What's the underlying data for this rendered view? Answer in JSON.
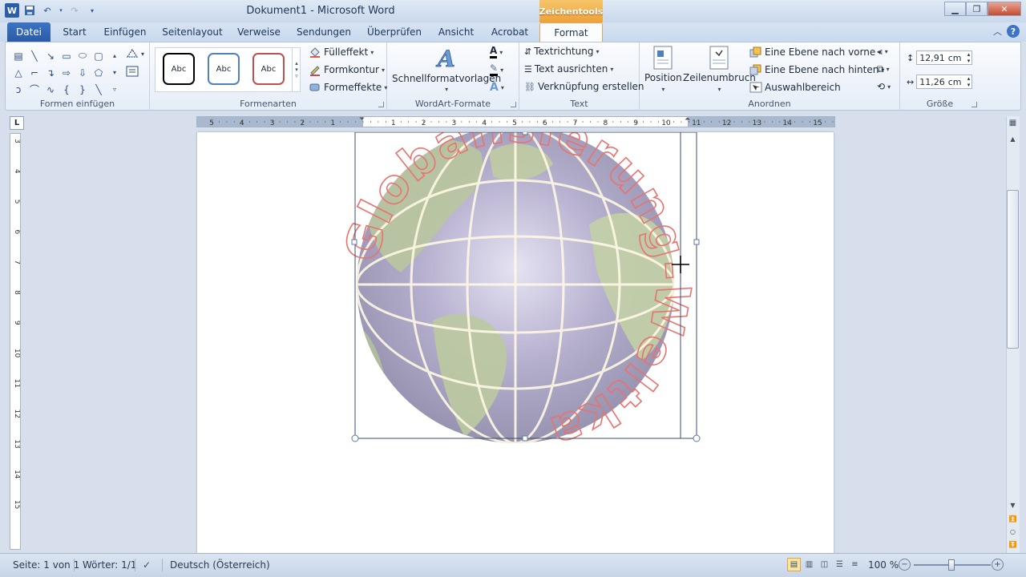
{
  "window": {
    "title": "Dokument1 - Microsoft Word",
    "contextual_tab": "Zeichentools"
  },
  "tabs": [
    {
      "label": "Datei"
    },
    {
      "label": "Start"
    },
    {
      "label": "Einfügen"
    },
    {
      "label": "Seitenlayout"
    },
    {
      "label": "Verweise"
    },
    {
      "label": "Sendungen"
    },
    {
      "label": "Überprüfen"
    },
    {
      "label": "Ansicht"
    },
    {
      "label": "Acrobat"
    },
    {
      "label": "Format"
    }
  ],
  "ribbon": {
    "groups": {
      "insert_shapes": "Formen einfügen",
      "shape_styles": "Formenarten",
      "wordart": "WordArt-Formate",
      "text": "Text",
      "arrange": "Anordnen",
      "size": "Größe"
    },
    "style_sample": "Abc",
    "fill": "Fülleffekt",
    "outline": "Formkontur",
    "effects": "Formeffekte",
    "quick_styles": "Schnellformatvorlagen",
    "text_direction": "Textrichtung",
    "align_text": "Text ausrichten",
    "create_link": "Verknüpfung erstellen",
    "position": "Position",
    "wrap_text": "Zeilenumbruch",
    "bring_forward": "Eine Ebene nach vorne",
    "send_backward": "Eine Ebene nach hinten",
    "selection_pane": "Auswahlbereich",
    "height_value": "12,91",
    "width_value": "11,26",
    "unit": "cm"
  },
  "ruler_corner": "L",
  "ruler_labels": [
    "5",
    "4",
    "3",
    "2",
    "1",
    "1",
    "2",
    "3",
    "4",
    "5",
    "6",
    "7",
    "8",
    "9",
    "10",
    "11",
    "12",
    "13",
    "14",
    "15"
  ],
  "vertical_ruler_labels": [
    "3",
    "4",
    "5",
    "6",
    "7",
    "8",
    "9",
    "10",
    "11",
    "12",
    "13",
    "14",
    "15"
  ],
  "wordart_text": "Globalisierung-Weltkarte",
  "status": {
    "page": "Seite: 1 von 1",
    "words": "Wörter: 1/1",
    "language": "Deutsch (Österreich)",
    "zoom": "100 %"
  },
  "colors": {
    "accent": "#2b579a",
    "contextual": "#eea13a",
    "wordart_outline": "#e8736e"
  }
}
